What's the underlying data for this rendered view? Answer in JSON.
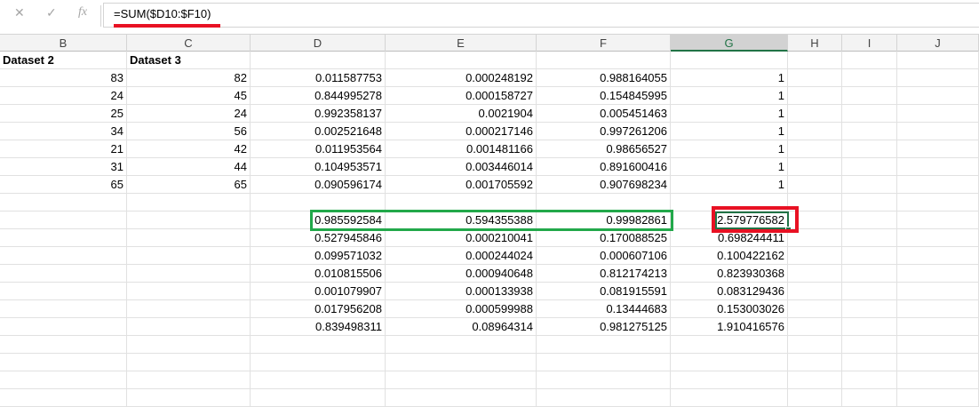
{
  "formula_bar": {
    "cancel_icon": "✕",
    "enter_icon": "✓",
    "function_icon": "fx",
    "formula": "=SUM($D10:$F10)"
  },
  "columns": [
    "B",
    "C",
    "D",
    "E",
    "F",
    "G",
    "H",
    "I",
    "J"
  ],
  "selected_column": "G",
  "rows": [
    [
      "Dataset 2",
      "Dataset 3",
      "",
      "",
      "",
      "",
      "",
      "",
      ""
    ],
    [
      "83",
      "82",
      "0.011587753",
      "0.000248192",
      "0.988164055",
      "1",
      "",
      "",
      ""
    ],
    [
      "24",
      "45",
      "0.844995278",
      "0.000158727",
      "0.154845995",
      "1",
      "",
      "",
      ""
    ],
    [
      "25",
      "24",
      "0.992358137",
      "0.0021904",
      "0.005451463",
      "1",
      "",
      "",
      ""
    ],
    [
      "34",
      "56",
      "0.002521648",
      "0.000217146",
      "0.997261206",
      "1",
      "",
      "",
      ""
    ],
    [
      "21",
      "42",
      "0.011953564",
      "0.001481166",
      "0.98656527",
      "1",
      "",
      "",
      ""
    ],
    [
      "31",
      "44",
      "0.104953571",
      "0.003446014",
      "0.891600416",
      "1",
      "",
      "",
      ""
    ],
    [
      "65",
      "65",
      "0.090596174",
      "0.001705592",
      "0.907698234",
      "1",
      "",
      "",
      ""
    ],
    [
      "",
      "",
      "",
      "",
      "",
      "",
      "",
      "",
      ""
    ],
    [
      "",
      "",
      "0.985592584",
      "0.594355388",
      "0.99982861",
      "2.579776582",
      "",
      "",
      ""
    ],
    [
      "",
      "",
      "0.527945846",
      "0.000210041",
      "0.170088525",
      "0.698244411",
      "",
      "",
      ""
    ],
    [
      "",
      "",
      "0.099571032",
      "0.000244024",
      "0.000607106",
      "0.100422162",
      "",
      "",
      ""
    ],
    [
      "",
      "",
      "0.010815506",
      "0.000940648",
      "0.812174213",
      "0.823930368",
      "",
      "",
      ""
    ],
    [
      "",
      "",
      "0.001079907",
      "0.000133938",
      "0.081915591",
      "0.083129436",
      "",
      "",
      ""
    ],
    [
      "",
      "",
      "0.017956208",
      "0.000599988",
      "0.13444683",
      "0.153003026",
      "",
      "",
      ""
    ],
    [
      "",
      "",
      "0.839498311",
      "0.08964314",
      "0.981275125",
      "1.910416576",
      "",
      "",
      ""
    ],
    [
      "",
      "",
      "",
      "",
      "",
      "",
      "",
      "",
      ""
    ],
    [
      "",
      "",
      "",
      "",
      "",
      "",
      "",
      "",
      ""
    ],
    [
      "",
      "",
      "",
      "",
      "",
      "",
      "",
      "",
      ""
    ],
    [
      "",
      "",
      "",
      "",
      "",
      "",
      "",
      "",
      ""
    ]
  ],
  "colors": {
    "highlight_green": "#22a84a",
    "highlight_red": "#e81123",
    "excel_green": "#217346"
  }
}
